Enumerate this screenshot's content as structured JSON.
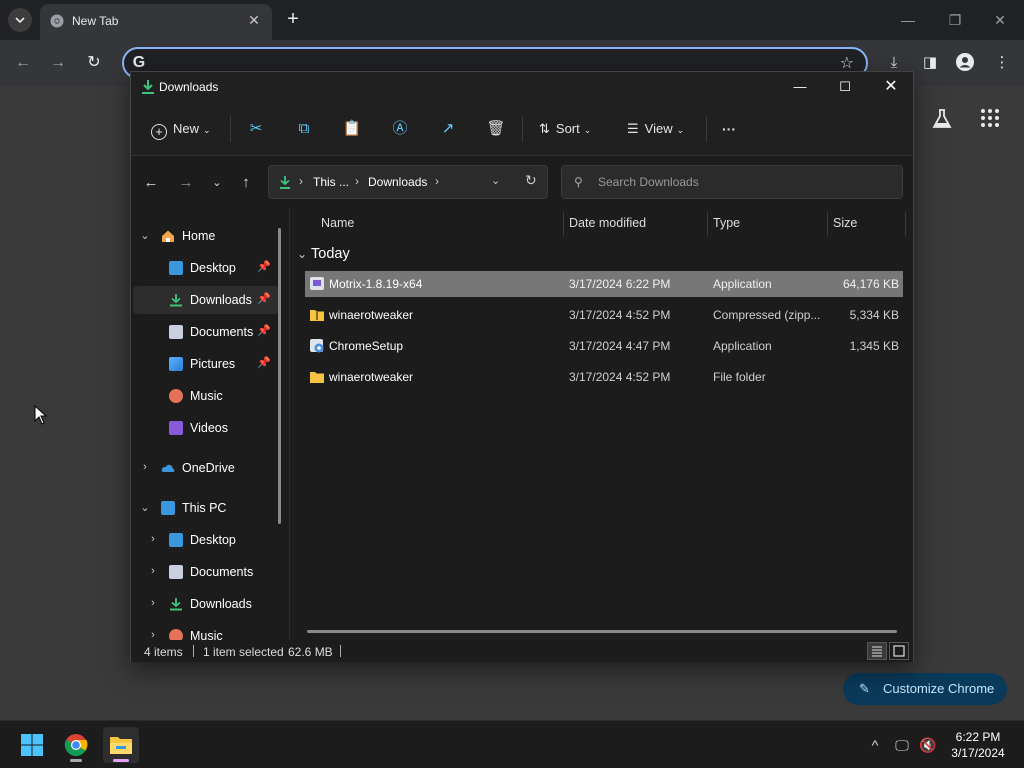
{
  "chrome": {
    "tab_title": "New Tab",
    "omnibox_value": "",
    "customize_label": "Customize Chrome"
  },
  "explorer": {
    "window_title": "Downloads",
    "toolbar": {
      "new_label": "New",
      "sort_label": "Sort",
      "view_label": "View",
      "more_label": "···"
    },
    "breadcrumb": [
      "This ...",
      "Downloads"
    ],
    "search_placeholder": "Search Downloads",
    "nav": [
      {
        "label": "Home",
        "icon": "home-icon"
      },
      {
        "label": "Desktop",
        "icon": "desktop-icon"
      },
      {
        "label": "Downloads",
        "icon": "download-icon"
      },
      {
        "label": "Documents",
        "icon": "documents-icon"
      },
      {
        "label": "Pictures",
        "icon": "pictures-icon"
      },
      {
        "label": "Music",
        "icon": "music-icon"
      },
      {
        "label": "Videos",
        "icon": "videos-icon"
      },
      {
        "label": "OneDrive",
        "icon": "cloud-icon"
      },
      {
        "label": "This PC",
        "icon": "pc-icon"
      },
      {
        "label": "Desktop",
        "icon": "desktop-icon"
      },
      {
        "label": "Documents",
        "icon": "documents-icon"
      },
      {
        "label": "Downloads",
        "icon": "download-icon"
      },
      {
        "label": "Music",
        "icon": "music-icon"
      }
    ],
    "columns": {
      "name": "Name",
      "date": "Date modified",
      "type": "Type",
      "size": "Size"
    },
    "group_label": "Today",
    "files": [
      {
        "name": "Motrix-1.8.19-x64",
        "date": "3/17/2024 6:22 PM",
        "type": "Application",
        "size": "64,176 KB"
      },
      {
        "name": "winaerotweaker",
        "date": "3/17/2024 4:52 PM",
        "type": "Compressed (zipp...",
        "size": "5,334 KB"
      },
      {
        "name": "ChromeSetup",
        "date": "3/17/2024 4:47 PM",
        "type": "Application",
        "size": "1,345 KB"
      },
      {
        "name": "winaerotweaker",
        "date": "3/17/2024 4:52 PM",
        "type": "File folder",
        "size": ""
      }
    ],
    "status": {
      "items": "4 items",
      "selected": "1 item selected",
      "size": "62.6 MB"
    }
  },
  "taskbar": {
    "time": "6:22 PM",
    "date": "3/17/2024"
  },
  "colors": {
    "accent": "#60cdff",
    "folder": "#f5c542",
    "chrome_focus": "#8ab4f8"
  }
}
